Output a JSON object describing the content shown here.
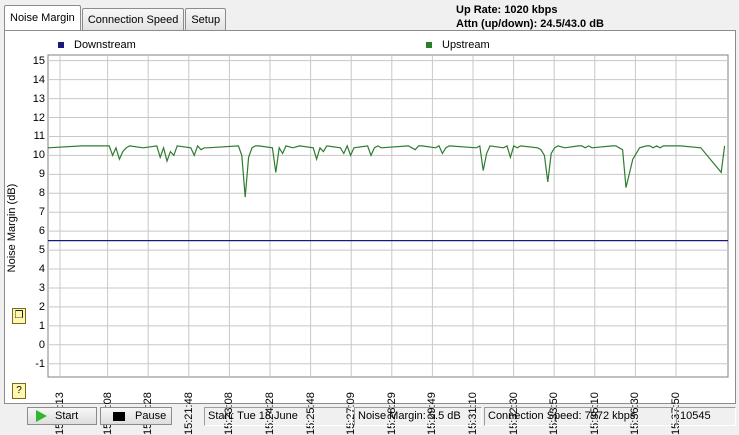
{
  "tabs": [
    {
      "label": "Noise Margin",
      "active": true
    },
    {
      "label": "Connection Speed",
      "active": false
    },
    {
      "label": "Setup",
      "active": false
    }
  ],
  "info": {
    "up_rate": "Up Rate: 1020 kbps",
    "attn": "Attn (up/down): 24.5/43.0 dB"
  },
  "colors": {
    "downstream": "#1a1a7a",
    "upstream": "#2e7d2e",
    "grid": "#c8c8c8",
    "start_icon": "#2eb82e"
  },
  "chart_data": {
    "type": "line",
    "ylabel": "Noise Margin (dB)",
    "ylim": [
      -1.7,
      15.3
    ],
    "yticks": [
      "15",
      "14",
      "13",
      "12",
      "11",
      "10",
      "9",
      "8",
      "7",
      "6",
      "5",
      "4",
      "3",
      "2",
      "1",
      "0",
      "-1"
    ],
    "xticks": [
      "15:18:13",
      "15:19:08",
      "15:20:28",
      "15:21:48",
      "15:23:08",
      "15:24:28",
      "15:25:48",
      "15:27:09",
      "15:28:29",
      "15:29:49",
      "15:31:10",
      "15:32:30",
      "15:33:50",
      "15:35:10",
      "15:36:30",
      "15:37:50"
    ],
    "legend_position": "top",
    "grid": true,
    "series": [
      {
        "name": "Downstream",
        "values": [
          5.5,
          5.5
        ],
        "x_fraction": [
          0,
          1
        ]
      },
      {
        "name": "Upstream",
        "x_fraction": [
          0,
          0.05,
          0.09,
          0.095,
          0.1,
          0.105,
          0.11,
          0.115,
          0.12,
          0.14,
          0.16,
          0.165,
          0.17,
          0.175,
          0.18,
          0.185,
          0.19,
          0.21,
          0.215,
          0.22,
          0.225,
          0.23,
          0.235,
          0.28,
          0.285,
          0.29,
          0.295,
          0.3,
          0.305,
          0.31,
          0.33,
          0.335,
          0.34,
          0.345,
          0.35,
          0.36,
          0.37,
          0.39,
          0.395,
          0.4,
          0.405,
          0.41,
          0.43,
          0.435,
          0.44,
          0.445,
          0.45,
          0.47,
          0.475,
          0.48,
          0.485,
          0.49,
          0.53,
          0.535,
          0.54,
          0.545,
          0.55,
          0.57,
          0.575,
          0.58,
          0.585,
          0.59,
          0.63,
          0.635,
          0.64,
          0.645,
          0.65,
          0.67,
          0.675,
          0.68,
          0.685,
          0.69,
          0.695,
          0.72,
          0.725,
          0.73,
          0.735,
          0.74,
          0.745,
          0.75,
          0.76,
          0.78,
          0.785,
          0.79,
          0.795,
          0.8,
          0.83,
          0.835,
          0.84,
          0.845,
          0.85,
          0.86,
          0.87,
          0.88,
          0.885,
          0.89,
          0.895,
          0.9,
          0.905,
          0.93,
          0.96,
          0.99,
          0.995,
          1.0
        ],
        "values": [
          10.4,
          10.5,
          10.5,
          10.0,
          10.4,
          9.8,
          10.2,
          10.4,
          10.5,
          10.4,
          10.5,
          9.9,
          10.4,
          9.7,
          10.2,
          10.0,
          10.5,
          10.4,
          10.0,
          10.5,
          10.3,
          10.4,
          10.4,
          10.5,
          10.0,
          7.8,
          9.9,
          10.4,
          10.5,
          10.5,
          10.4,
          9.1,
          10.4,
          10.1,
          10.5,
          10.4,
          10.5,
          10.4,
          9.8,
          10.4,
          10.2,
          10.5,
          10.4,
          10.1,
          10.5,
          10.0,
          10.4,
          10.5,
          10.0,
          10.4,
          10.5,
          10.4,
          10.5,
          10.4,
          10.3,
          10.5,
          10.5,
          10.4,
          10.5,
          10.1,
          10.4,
          10.5,
          10.4,
          10.5,
          9.2,
          10.1,
          10.5,
          10.4,
          10.5,
          9.9,
          10.5,
          10.4,
          10.5,
          10.4,
          10.3,
          10.0,
          8.6,
          10.1,
          10.4,
          10.5,
          10.4,
          10.5,
          10.5,
          10.4,
          10.5,
          10.4,
          10.5,
          10.5,
          10.4,
          10.3,
          8.3,
          9.8,
          10.4,
          10.5,
          10.5,
          10.4,
          10.5,
          10.4,
          10.5,
          10.5,
          10.4,
          9.1,
          10.5
        ]
      }
    ]
  },
  "buttons": {
    "start": "Start",
    "pause": "Pause"
  },
  "status": {
    "start_date": "Start: Tue 18 June",
    "noise_margin": "Noise Margin: 5.5 dB",
    "connection_speed": "Connection Speed: 7972 kbps",
    "count": "10545"
  }
}
